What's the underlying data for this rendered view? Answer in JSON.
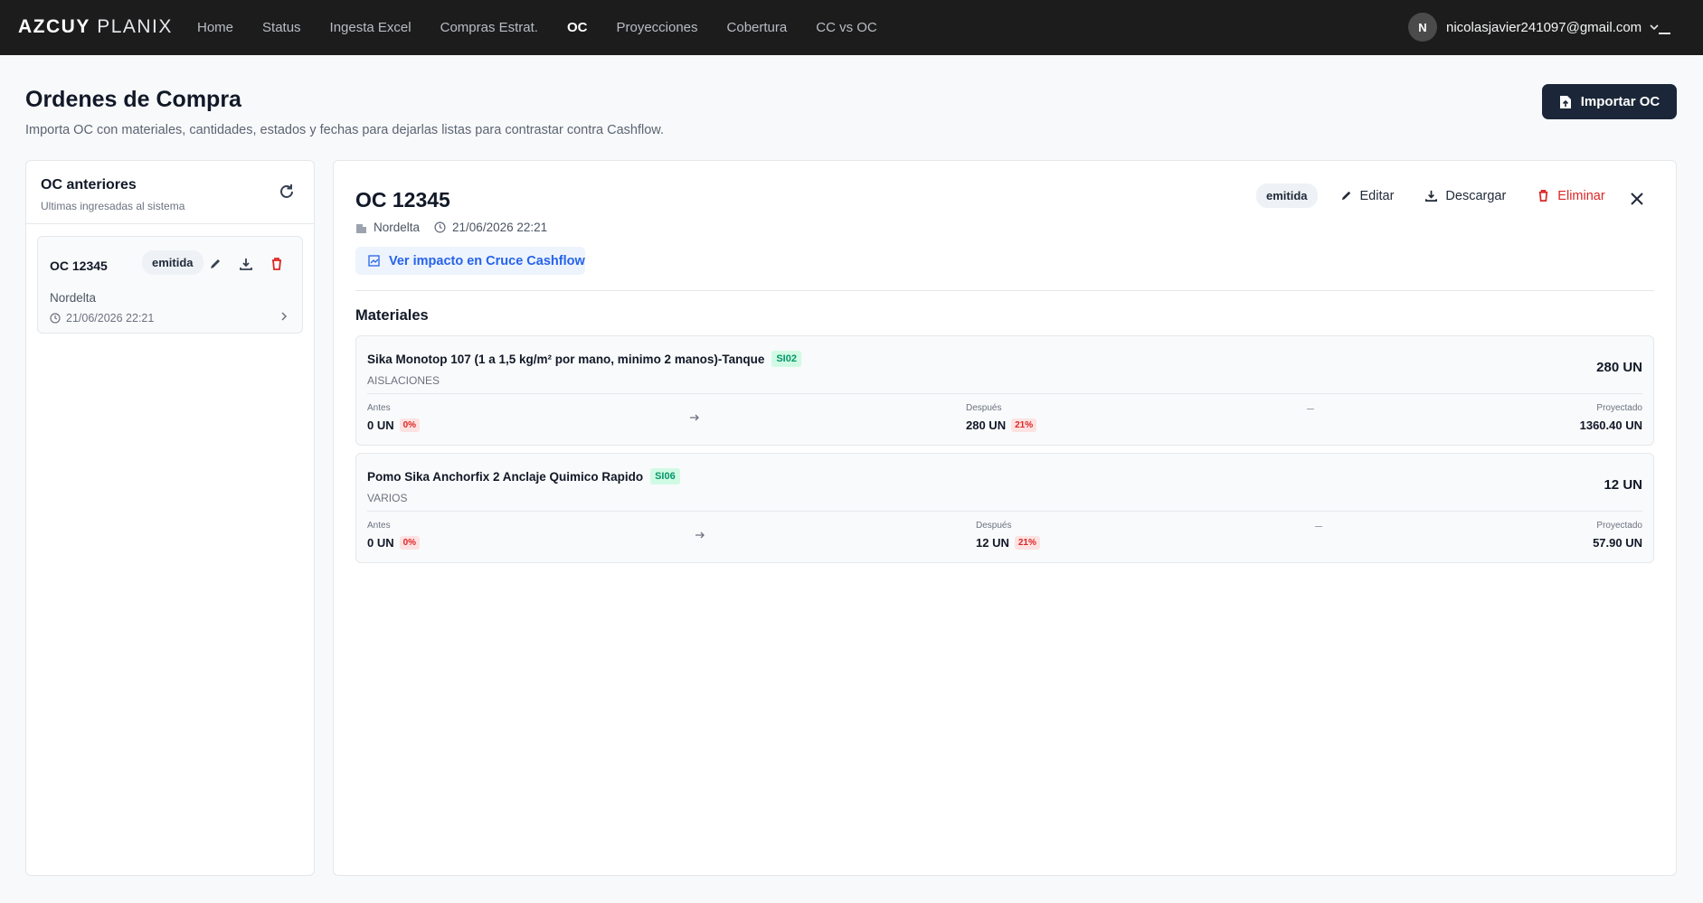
{
  "brand": {
    "bold": "AZCUY",
    "light": "PLANIX"
  },
  "nav": [
    {
      "label": "Home",
      "active": false
    },
    {
      "label": "Status",
      "active": false
    },
    {
      "label": "Ingesta Excel",
      "active": false
    },
    {
      "label": "Compras Estrat.",
      "active": false
    },
    {
      "label": "OC",
      "active": true
    },
    {
      "label": "Proyecciones",
      "active": false
    },
    {
      "label": "Cobertura",
      "active": false
    },
    {
      "label": "CC vs OC",
      "active": false
    }
  ],
  "user": {
    "initial": "N",
    "email": "nicolasjavier241097@gmail.com"
  },
  "header": {
    "title": "Ordenes de Compra",
    "subtitle": "Importa OC con materiales, cantidades, estados y fechas para dejarlas listas para contrastar contra Cashflow.",
    "import_label": "Importar OC"
  },
  "left": {
    "title": "OC anteriores",
    "subtitle": "Ultimas ingresadas al sistema",
    "card": {
      "number": "OC 12345",
      "status": "emitida",
      "location": "Nordelta",
      "date": "21/06/2026 22:21"
    }
  },
  "detail": {
    "title": "OC 12345",
    "location": "Nordelta",
    "date": "21/06/2026 22:21",
    "impact_label": "Ver impacto en Cruce Cashflow",
    "status": "emitida",
    "edit_label": "Editar",
    "download_label": "Descargar",
    "delete_label": "Eliminar",
    "materials_title": "Materiales",
    "materials": [
      {
        "name": "Sika Monotop 107 (1 a 1,5 kg/m² por mano,  minimo 2 manos)-Tanque",
        "code": "SI02",
        "category": "AISLACIONES",
        "qty": "280 UN",
        "before_label": "Antes",
        "before": "0 UN",
        "before_pct": "0%",
        "after_label": "Después",
        "after": "280 UN",
        "after_pct": "21%",
        "proj_label": "Proyectado",
        "proj": "1360.40 UN"
      },
      {
        "name": "Pomo Sika Anchorfix 2 Anclaje Quimico Rapido",
        "code": "SI06",
        "category": "VARIOS",
        "qty": "12 UN",
        "before_label": "Antes",
        "before": "0 UN",
        "before_pct": "0%",
        "after_label": "Después",
        "after": "12 UN",
        "after_pct": "21%",
        "proj_label": "Proyectado",
        "proj": "57.90 UN"
      }
    ]
  }
}
